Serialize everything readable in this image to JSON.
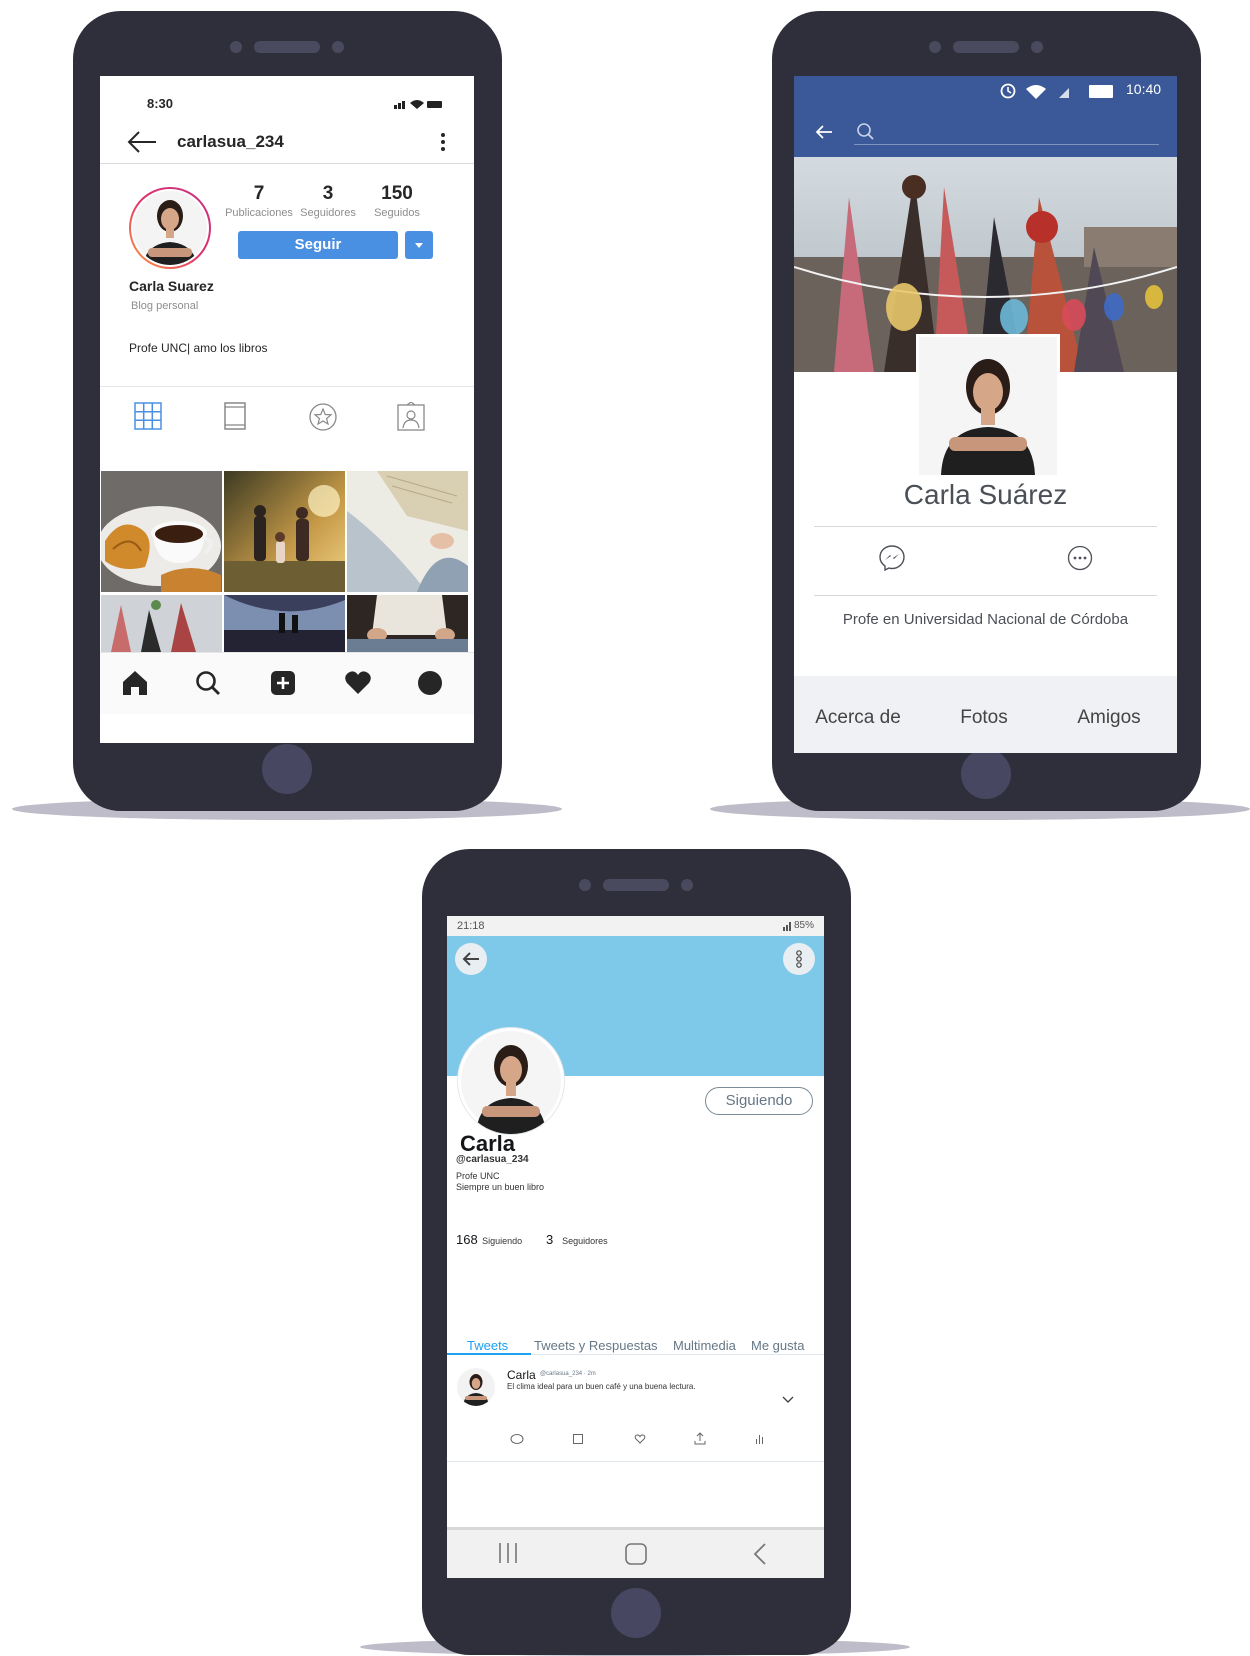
{
  "instagram": {
    "status": {
      "time": "8:30"
    },
    "header": {
      "username": "carlasua_234"
    },
    "stats": [
      {
        "value": "7",
        "label": "Publicaciones"
      },
      {
        "value": "3",
        "label": "Seguidores"
      },
      {
        "value": "150",
        "label": "Seguidos"
      }
    ],
    "follow_label": "Seguir",
    "name": "Carla Suarez",
    "category": "Blog personal",
    "bio": "Profe UNC| amo los libros",
    "accent": "#4a90e2"
  },
  "facebook": {
    "status": {
      "time": "10:40"
    },
    "name": "Carla Suárez",
    "bio": "Profe en Universidad Nacional de Córdoba",
    "tabs": [
      "Acerca de",
      "Fotos",
      "Amigos"
    ],
    "header_color": "#3b5998"
  },
  "twitter": {
    "status": {
      "time": "21:18",
      "battery": "85%"
    },
    "follow_state": "Siguiendo",
    "name": "Carla",
    "handle": "@carlasua_234",
    "bio_line1": "Profe UNC",
    "bio_line2": "Siempre un buen libro",
    "following_count": "168",
    "following_label": "Siguiendo",
    "followers_count": "3",
    "followers_label": "Seguidores",
    "tabs": [
      "Tweets",
      "Tweets y Respuestas",
      "Multimedia",
      "Me gusta"
    ],
    "tweet": {
      "author": "Carla",
      "meta": "@carlasua_234 · 2m",
      "text": "El clima ideal para un buen café y una buena lectura."
    },
    "banner_color": "#7ec8ea",
    "accent": "#1da1f2"
  }
}
